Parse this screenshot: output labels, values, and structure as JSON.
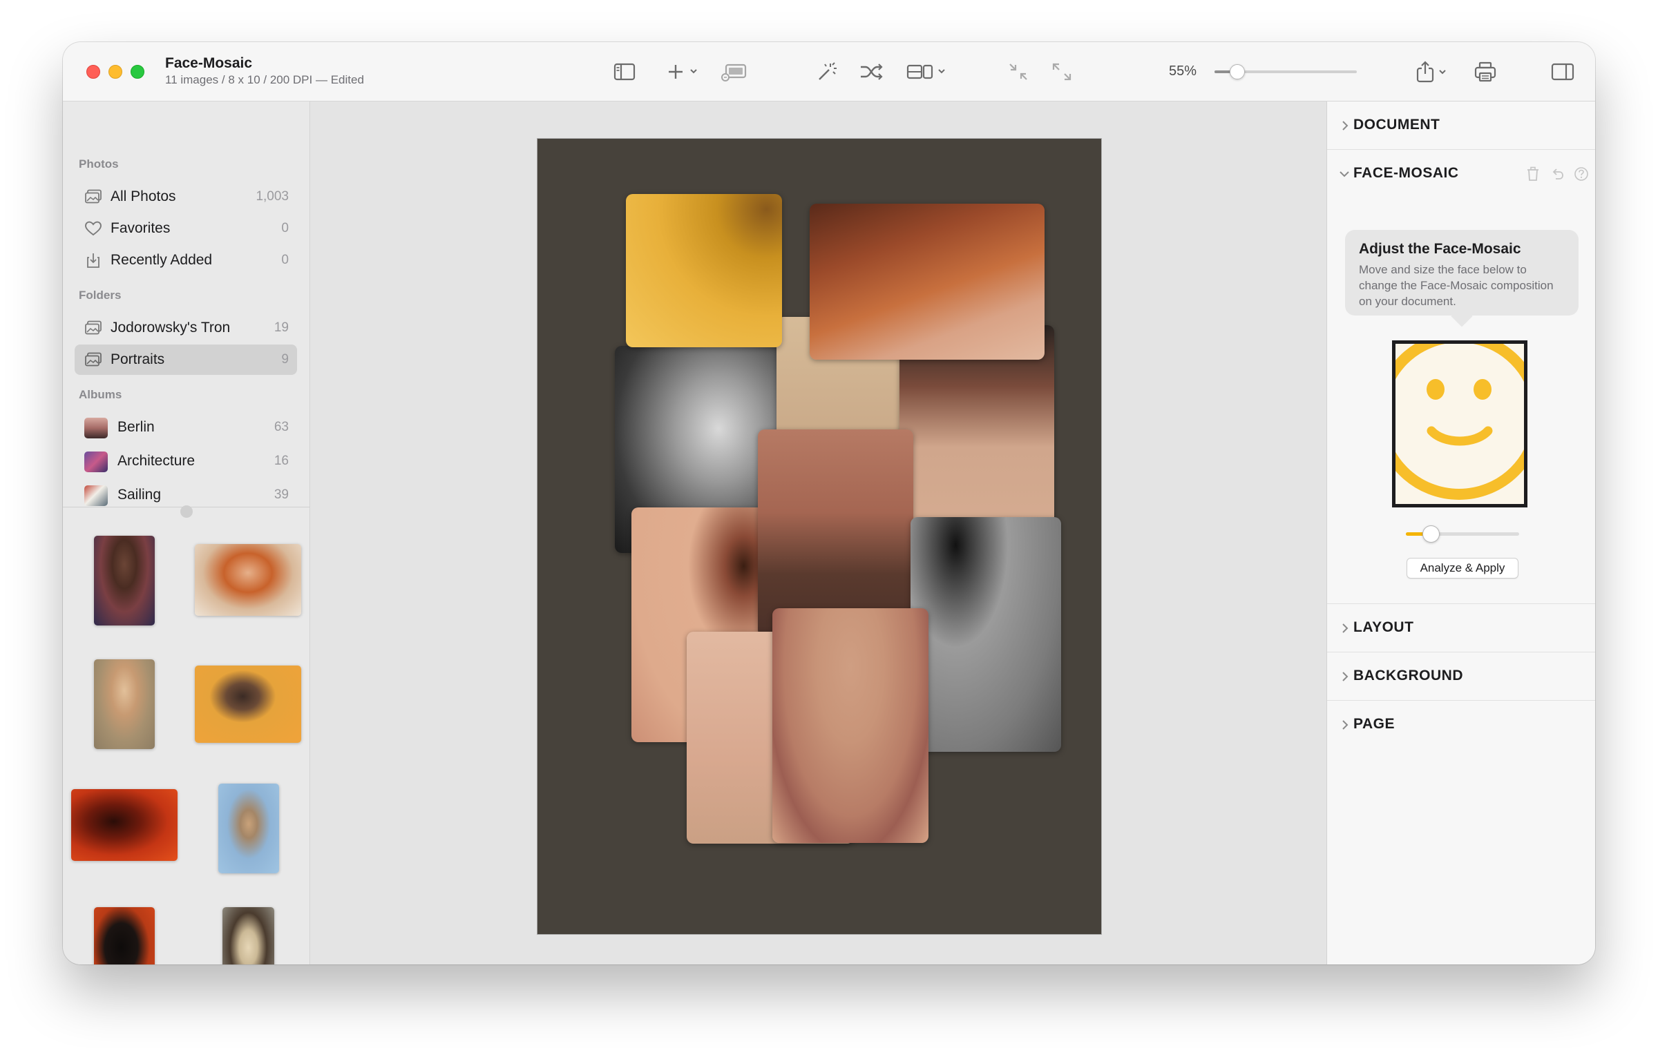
{
  "window": {
    "title": "Face-Mosaic",
    "subtitle": "11 images / 8 x 10 / 200 DPI — Edited"
  },
  "toolbar": {
    "zoom_label": "55%",
    "zoom_level": 0.16,
    "icons": [
      "sidebar-icon",
      "add-icon",
      "slideshow-icon",
      "magic-wand-icon",
      "shuffle-icon",
      "layout-icon",
      "shrink-icon",
      "expand-icon",
      "share-icon",
      "print-icon",
      "inspector-icon"
    ]
  },
  "sidebar": {
    "photos_header": "Photos",
    "photos": [
      {
        "label": "All Photos",
        "count": "1,003"
      },
      {
        "label": "Favorites",
        "count": "0"
      },
      {
        "label": "Recently Added",
        "count": "0"
      }
    ],
    "folders_header": "Folders",
    "folders": [
      {
        "label": "Jodorowsky's Tron",
        "count": "19"
      },
      {
        "label": "Portraits",
        "count": "9",
        "selected": true
      }
    ],
    "albums_header": "Albums",
    "albums": [
      {
        "label": "Berlin",
        "count": "63"
      },
      {
        "label": "Architecture",
        "count": "16"
      },
      {
        "label": "Sailing",
        "count": "39"
      }
    ]
  },
  "inspector": {
    "document": "DOCUMENT",
    "face_mosaic": "FACE-MOSAIC",
    "callout_title": "Adjust the Face-Mosaic",
    "callout_body": "Move and size the face below to change the Face-Mosaic composition on your document.",
    "size_level": 0.22,
    "analyze_button": "Analyze & Apply",
    "layout": "LAYOUT",
    "background": "BACKGROUND",
    "page": "PAGE",
    "accent_color": "#f4b400"
  }
}
